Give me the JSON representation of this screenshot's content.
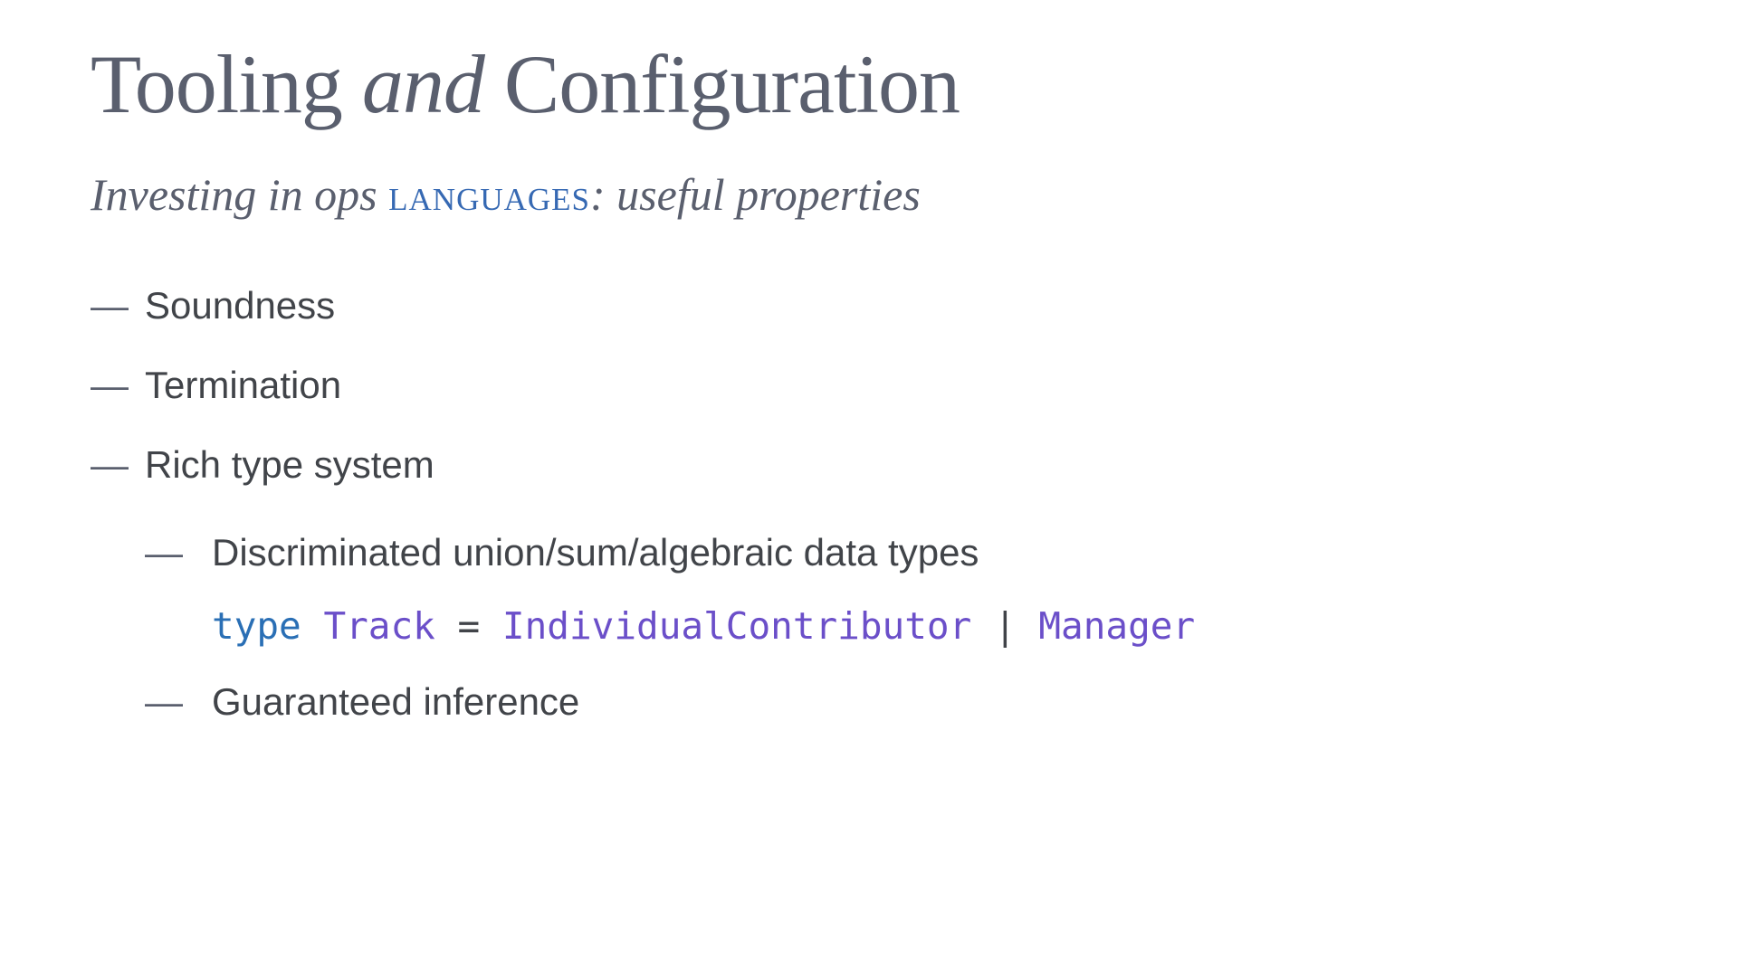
{
  "title": {
    "part1": "Tooling",
    "italic": " and ",
    "part2": "Configuration"
  },
  "subtitle": {
    "prefix": "Investing in ops ",
    "smallcaps": "LANGUAGES",
    "suffix": ": useful properties"
  },
  "items": [
    "Soundness",
    "Termination",
    "Rich type system"
  ],
  "subitems": [
    "Discriminated union/sum/algebraic data types",
    "Guaranteed inference"
  ],
  "code": {
    "kw": "type",
    "name": "Track",
    "eq": " = ",
    "variant1": "IndividualContributor",
    "pipe": " | ",
    "variant2": "Manager"
  }
}
